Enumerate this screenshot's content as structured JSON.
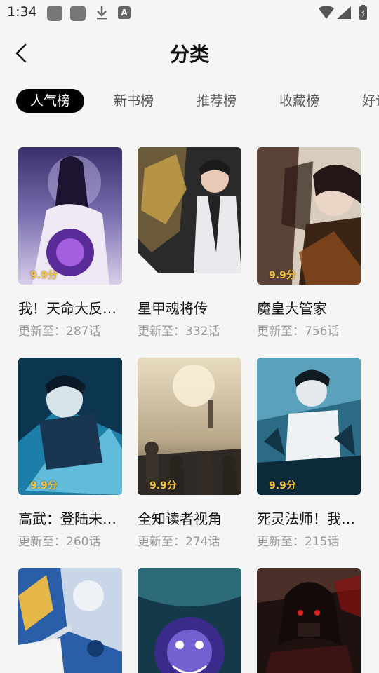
{
  "status_bar": {
    "time": "1:34",
    "a_badge": "A"
  },
  "header": {
    "title": "分类"
  },
  "tabs": [
    "人气榜",
    "新书榜",
    "推荐榜",
    "收藏榜",
    "好评榜"
  ],
  "update_prefix": "更新至：",
  "comics": [
    {
      "title": "我！天命大反…",
      "score": "9.9分",
      "update": "更新至：287话"
    },
    {
      "title": "星甲魂将传",
      "score": "",
      "update": "更新至：332话"
    },
    {
      "title": "魔皇大管家",
      "score": "9.9分",
      "update": "更新至：756话"
    },
    {
      "title": "高武：登陆未…",
      "score": "9.9分",
      "update": "更新至：260话"
    },
    {
      "title": "全知读者视角",
      "score": "9.9分",
      "update": "更新至：274话"
    },
    {
      "title": "死灵法师！我…",
      "score": "9.9分",
      "update": "更新至：215话"
    },
    {
      "title": "",
      "score": "",
      "update": ""
    },
    {
      "title": "",
      "score": "",
      "update": ""
    },
    {
      "title": "",
      "score": "",
      "update": ""
    }
  ],
  "colors": {
    "accent": "#000000",
    "score": "#f5c542",
    "muted": "#999999",
    "background": "#f5f5f5"
  },
  "icons": {
    "back": "back-arrow-icon",
    "download": "download-icon",
    "wifi": "wifi-icon",
    "signal": "signal-icon",
    "battery": "battery-icon"
  }
}
